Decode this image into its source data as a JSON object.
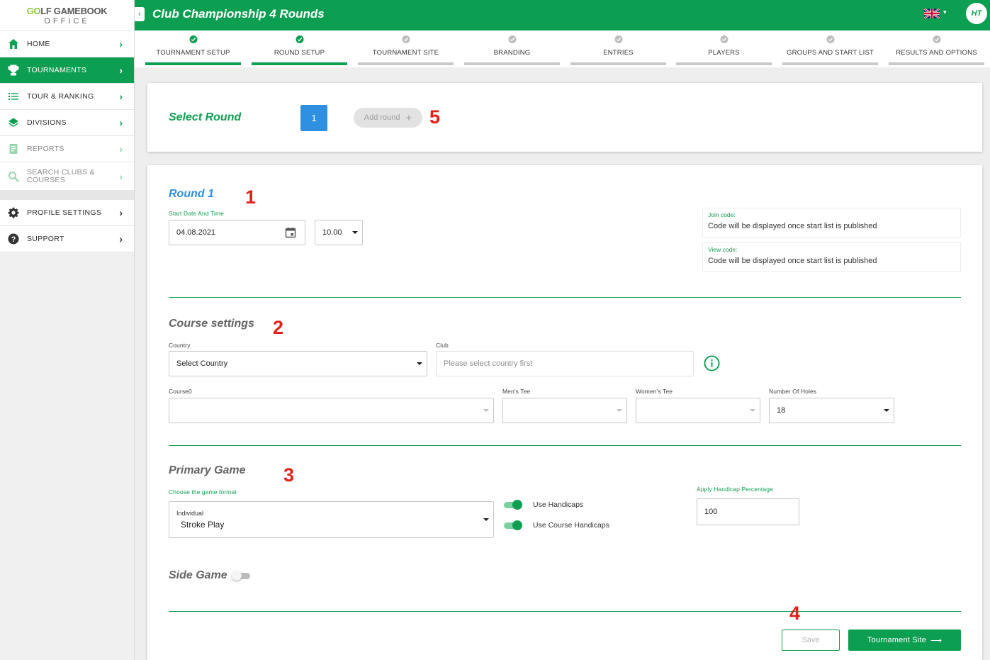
{
  "logo": {
    "top_golf_g": "G",
    "top_golf_o": "O",
    "top_golf_rest": "LF GAMEBOOK",
    "bottom": "OFFICE"
  },
  "sidebar": {
    "items": [
      {
        "label": "HOME",
        "icon": "home-icon"
      },
      {
        "label": "TOURNAMENTS",
        "icon": "trophy-icon",
        "active": true
      },
      {
        "label": "TOUR & RANKING",
        "icon": "list-icon"
      },
      {
        "label": "DIVISIONS",
        "icon": "layers-icon"
      },
      {
        "label": "REPORTS",
        "icon": "report-icon",
        "muted": true
      },
      {
        "label": "SEARCH CLUBS & COURSES",
        "icon": "search-icon",
        "muted": true
      },
      {
        "label": "PROFILE SETTINGS",
        "icon": "gear-icon"
      },
      {
        "label": "SUPPORT",
        "icon": "help-icon"
      }
    ],
    "chevron": "›"
  },
  "topbar": {
    "title": "Club Championship 4 Rounds",
    "collapse": "‹",
    "flag_caret": "▾",
    "avatar": "HT"
  },
  "steps": [
    {
      "label": "TOURNAMENT SETUP",
      "done": true
    },
    {
      "label": "ROUND SETUP",
      "done": true
    },
    {
      "label": "TOURNAMENT SITE",
      "done": false
    },
    {
      "label": "BRANDING",
      "done": false
    },
    {
      "label": "ENTRIES",
      "done": false
    },
    {
      "label": "PLAYERS",
      "done": false
    },
    {
      "label": "GROUPS AND START LIST",
      "done": false
    },
    {
      "label": "RESULTS AND OPTIONS",
      "done": false
    }
  ],
  "select_round": {
    "title": "Select Round",
    "round_chip": "1",
    "add_round": "Add round",
    "add_plus": "+"
  },
  "annotations": {
    "a1": "1",
    "a2": "2",
    "a3": "3",
    "a4": "4",
    "a5": "5"
  },
  "round": {
    "title": "Round 1",
    "start_label": "Start Date And Time",
    "date_value": "04.08.2021",
    "time_value": "10.00",
    "join_label": "Join code:",
    "join_value": "Code will be displayed once start list is published",
    "view_label": "View code:",
    "view_value": "Code will be displayed once start list is published"
  },
  "course": {
    "title": "Course settings",
    "country_label": "Country",
    "country_value": "Select Country",
    "club_label": "Club",
    "club_placeholder": "Please select country first",
    "course_label": "Course0",
    "course_value": "",
    "mens_tee_label": "Men's Tee",
    "womens_tee_label": "Women's Tee",
    "holes_label": "Number Of Holes",
    "holes_value": "18"
  },
  "primary_game": {
    "title": "Primary Game",
    "format_label": "Choose the game format",
    "format_category": "Individual",
    "format_value": "Stroke Play",
    "use_handicaps": "Use Handicaps",
    "use_handicaps_on": true,
    "use_course_handicaps": "Use Course Handicaps",
    "use_course_handicaps_on": true,
    "handicap_pct_label": "Apply Handicap Percentage",
    "handicap_pct_value": "100"
  },
  "side_game": {
    "title": "Side Game",
    "enabled": false
  },
  "buttons": {
    "save": "Save",
    "next": "Tournament Site",
    "next_arrow": "⟶"
  },
  "colors": {
    "brand_green": "#0d9f51",
    "accent_blue": "#2f8fe0",
    "annotation_red": "#e2231a"
  }
}
